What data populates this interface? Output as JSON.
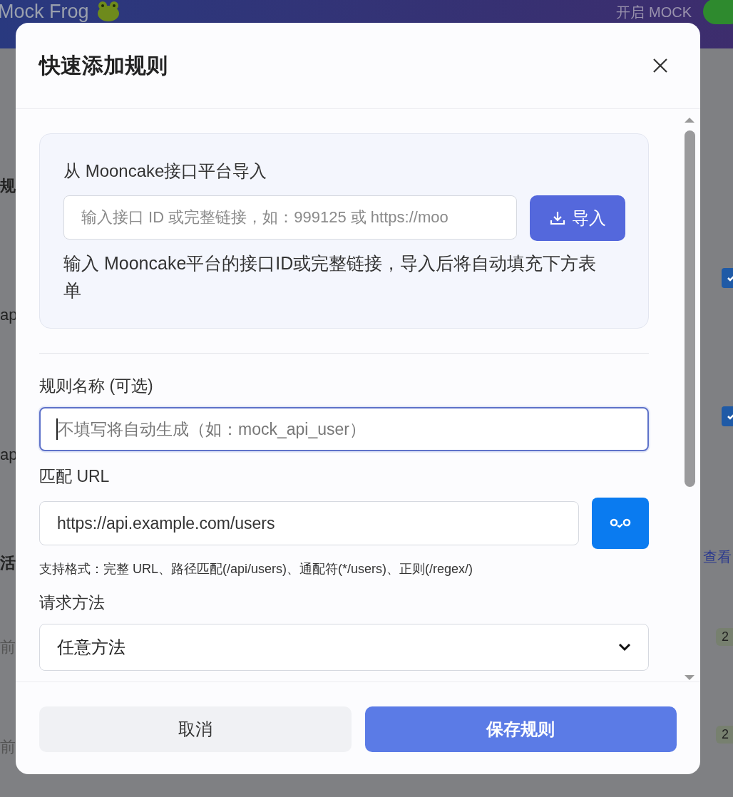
{
  "app": {
    "title": "Mock Frog",
    "mock_toggle": {
      "label": "开启 MOCK",
      "on": true
    },
    "left_fragments": [
      "规",
      "ap",
      "ap",
      "活",
      "前",
      "前"
    ],
    "right_checks": [
      {
        "checked": true
      },
      {
        "checked": true
      }
    ],
    "right_link": "查看",
    "right_badges": [
      "2",
      "2"
    ]
  },
  "dialog": {
    "title": "快速添加规则",
    "import": {
      "label": "从 Mooncake接口平台导入",
      "placeholder": "输入接口 ID 或完整链接，如：999125 或 https://moo",
      "button": "导入",
      "help": "输入 Mooncake平台的接口ID或完整链接，导入后将自动填充下方表单"
    },
    "fields": [
      {
        "kind": "text",
        "label": "规则名称 (可选)",
        "placeholder": "不填写将自动生成（如：mock_api_user）",
        "focused": true
      },
      {
        "kind": "url",
        "label": "匹配 URL",
        "value": "https://api.example.com/users",
        "focused": false,
        "hint": "支持格式：完整 URL、路径匹配(/api/users)、通配符(*/users)、正则(/regex/)"
      },
      {
        "kind": "select",
        "label": "请求方法",
        "value": "任意方法"
      }
    ],
    "buttons": [
      {
        "label": "取消",
        "kind": "secondary"
      },
      {
        "label": "保存规则",
        "kind": "primary"
      }
    ]
  }
}
